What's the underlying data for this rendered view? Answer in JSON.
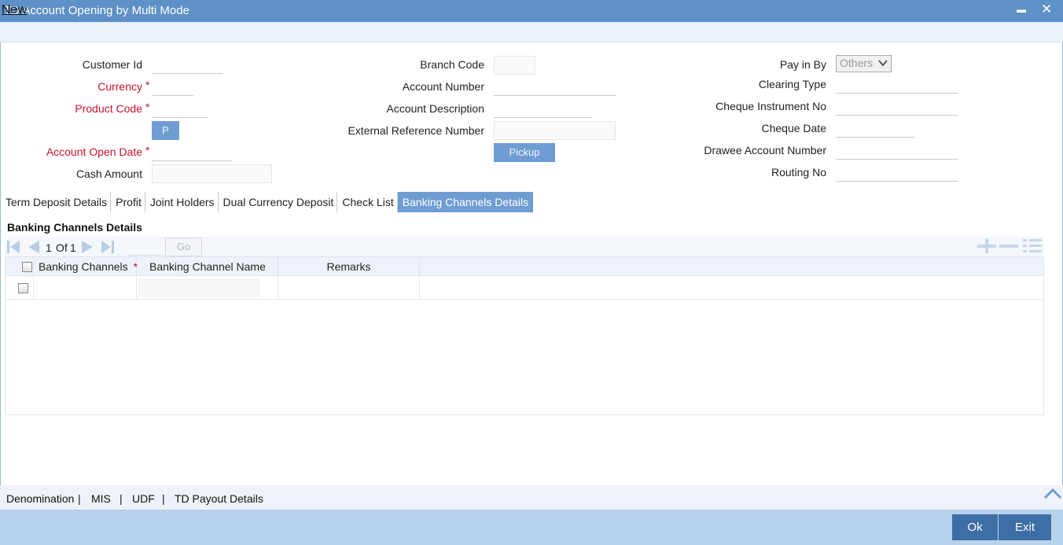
{
  "window": {
    "title": "TD Account Opening by Multi Mode",
    "minimize": "▬",
    "close": "✕"
  },
  "menu": {
    "new_label": "New"
  },
  "form": {
    "customer_id": {
      "label": "Customer Id",
      "value": ""
    },
    "currency": {
      "label": "Currency",
      "required": "*",
      "value": ""
    },
    "product_code": {
      "label": "Product Code",
      "required": "*",
      "value": ""
    },
    "p_button": "P",
    "account_open_date": {
      "label": "Account Open Date",
      "required": "*",
      "value": ""
    },
    "cash_amount": {
      "label": "Cash Amount",
      "value": ""
    },
    "branch_code": {
      "label": "Branch Code",
      "value": ""
    },
    "account_number": {
      "label": "Account Number",
      "value": ""
    },
    "account_description": {
      "label": "Account Description",
      "value": ""
    },
    "external_reference_number": {
      "label": "External Reference Number",
      "value": ""
    },
    "pickup_button": "Pickup",
    "pay_in_by": {
      "label": "Pay in By",
      "value": "Others"
    },
    "clearing_type": {
      "label": "Clearing Type",
      "value": ""
    },
    "cheque_instrument_no": {
      "label": "Cheque Instrument No",
      "value": ""
    },
    "cheque_date": {
      "label": "Cheque Date",
      "value": ""
    },
    "drawee_account_number": {
      "label": "Drawee Account Number",
      "value": ""
    },
    "routing_no": {
      "label": "Routing No",
      "value": ""
    }
  },
  "tabs": [
    {
      "label": "Term Deposit Details",
      "active": false
    },
    {
      "label": "Profit",
      "active": false
    },
    {
      "label": "Joint Holders",
      "active": false
    },
    {
      "label": "Dual Currency Deposit",
      "active": false
    },
    {
      "label": "Check List",
      "active": false
    },
    {
      "label": "Banking Channels Details",
      "active": true
    }
  ],
  "banking_channels": {
    "section_title": "Banking Channels Details",
    "pagination": {
      "current": "1",
      "of_label": "Of",
      "total": "1",
      "go_label": "Go"
    },
    "columns": {
      "banking_channels": "Banking Channels",
      "required": "*",
      "banking_channel_name": "Banking Channel Name",
      "remarks": "Remarks"
    },
    "rows": [
      {
        "banking_channels": "",
        "banking_channel_name": "",
        "remarks": ""
      }
    ]
  },
  "footer_links": [
    "Denomination",
    "MIS",
    "UDF",
    "TD Payout Details"
  ],
  "footer_separator": "|",
  "actions": {
    "ok": "Ok",
    "exit": "Exit"
  },
  "colors": {
    "title_bar": "#5d91c8",
    "accent": "#6f9dd3",
    "required": "#c8102e",
    "action_button": "#3d6fa6",
    "bottom_bar": "#b7d1ea"
  }
}
